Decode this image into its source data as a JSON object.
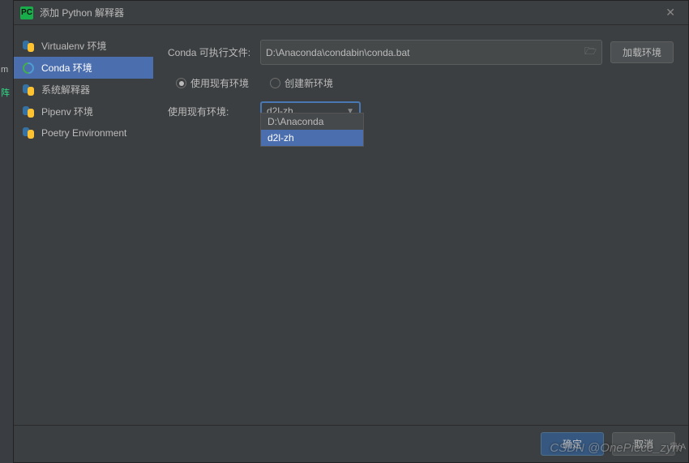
{
  "window": {
    "title": "添加 Python 解释器",
    "app_icon_text": "PC"
  },
  "sidebar": {
    "items": [
      {
        "label": "Virtualenv 环境",
        "icon": "python-icon"
      },
      {
        "label": "Conda 环境",
        "icon": "conda-icon",
        "selected": true
      },
      {
        "label": "系统解释器",
        "icon": "python-icon"
      },
      {
        "label": "Pipenv 环境",
        "icon": "python-icon"
      },
      {
        "label": "Poetry Environment",
        "icon": "python-icon"
      }
    ]
  },
  "main": {
    "conda_exe_label": "Conda 可执行文件:",
    "conda_exe_value": "D:\\Anaconda\\condabin\\conda.bat",
    "load_env_button": "加载环境",
    "radio_use_existing": "使用现有环境",
    "radio_create_new": "创建新环境",
    "use_existing_label": "使用现有环境:",
    "env_selected": "d2l-zh",
    "dropdown_options": [
      {
        "label": "D:\\Anaconda",
        "hover": false
      },
      {
        "label": "d2l-zh",
        "hover": true
      }
    ]
  },
  "buttons": {
    "ok": "确定",
    "cancel": "取消"
  },
  "watermark": "CSDN @OnePiece_zym",
  "gutter": {
    "m": "m",
    "f": "阵"
  },
  "side_badges": {
    "b": "串(A"
  }
}
